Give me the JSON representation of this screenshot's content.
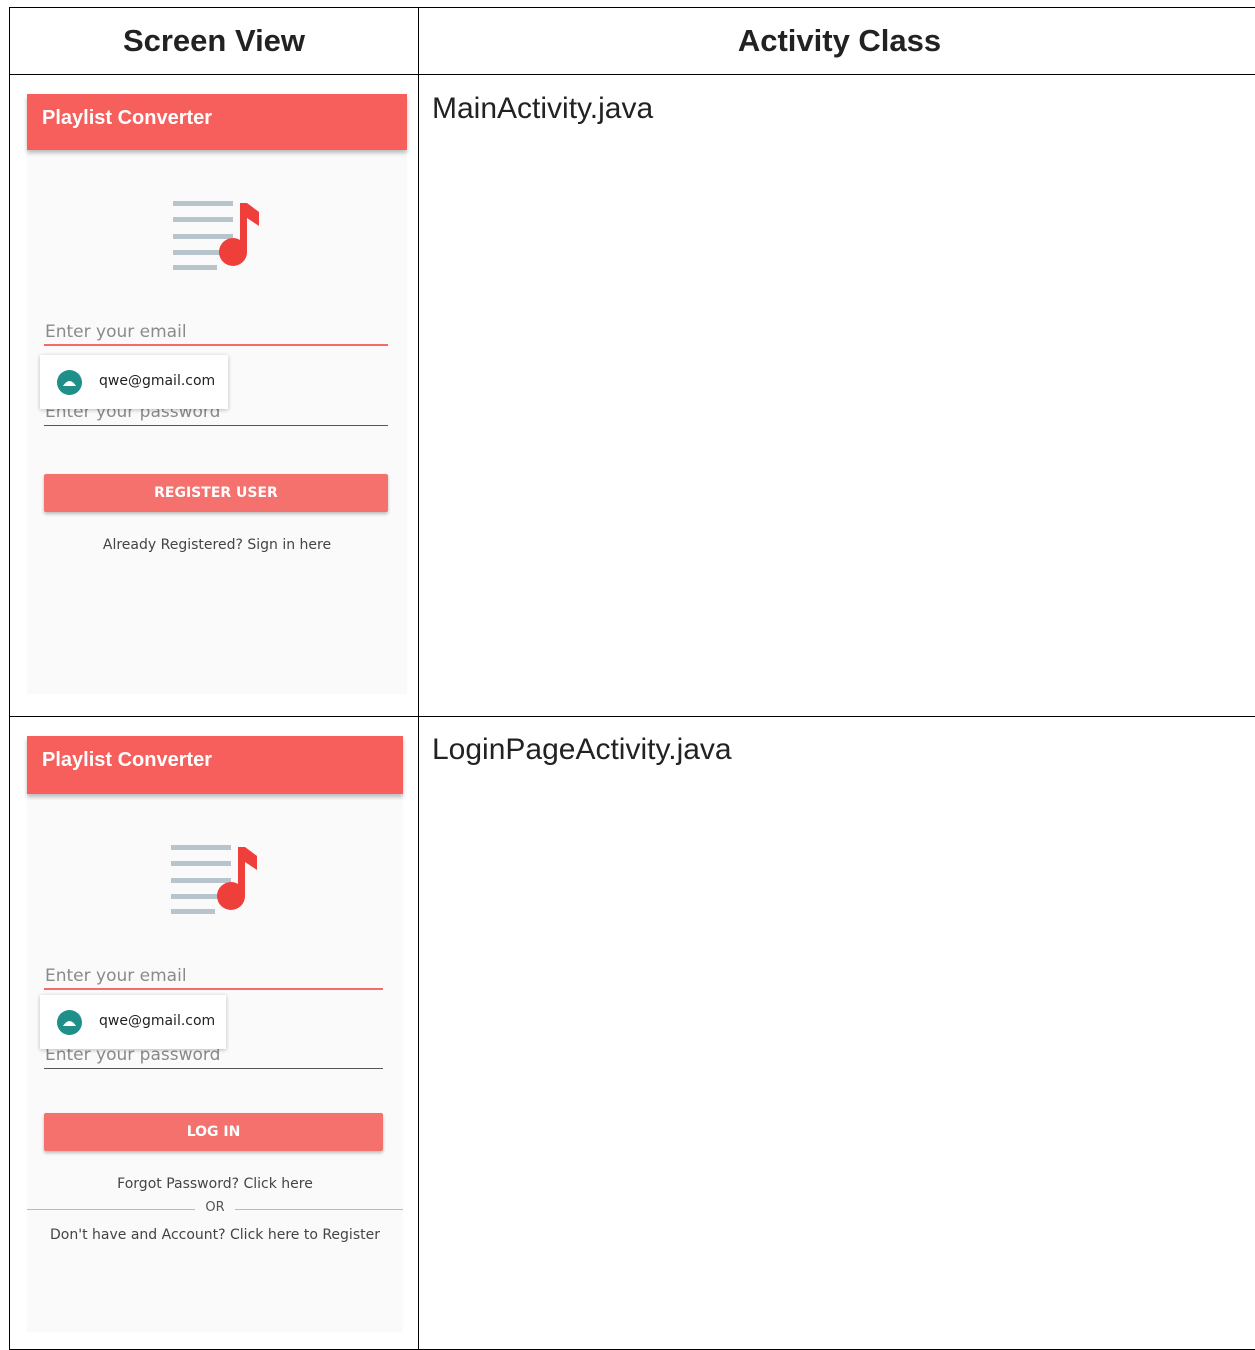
{
  "table": {
    "headers": [
      "Screen View",
      "Activity Class"
    ],
    "rows": [
      {
        "activity_class": "MainActivity.java",
        "screen": {
          "app_title": "Playlist Converter",
          "email_placeholder": "Enter your email",
          "password_placeholder": "Enter your password",
          "autofill_suggestion": "qwe@gmail.com",
          "button_label": "REGISTER USER",
          "link_text": "Already Registered? Sign in here"
        }
      },
      {
        "activity_class": "LoginPageActivity.java",
        "screen": {
          "app_title": "Playlist Converter",
          "email_placeholder": "Enter your email",
          "password_placeholder": "Enter your password",
          "autofill_suggestion": "qwe@gmail.com",
          "button_label": "LOG IN",
          "forgot_text": "Forgot Password? Click here",
          "or_text": "OR",
          "register_text": "Don't have and Account? Click here to Register"
        }
      }
    ]
  },
  "colors": {
    "app_bar": "#f65f5c",
    "button": "#f4716d",
    "note": "#ef3f3b",
    "lines": "#b7c4cc",
    "avatar": "#1f8f8a"
  },
  "icons": [
    "playlist-music-icon",
    "android-avatar-icon"
  ]
}
